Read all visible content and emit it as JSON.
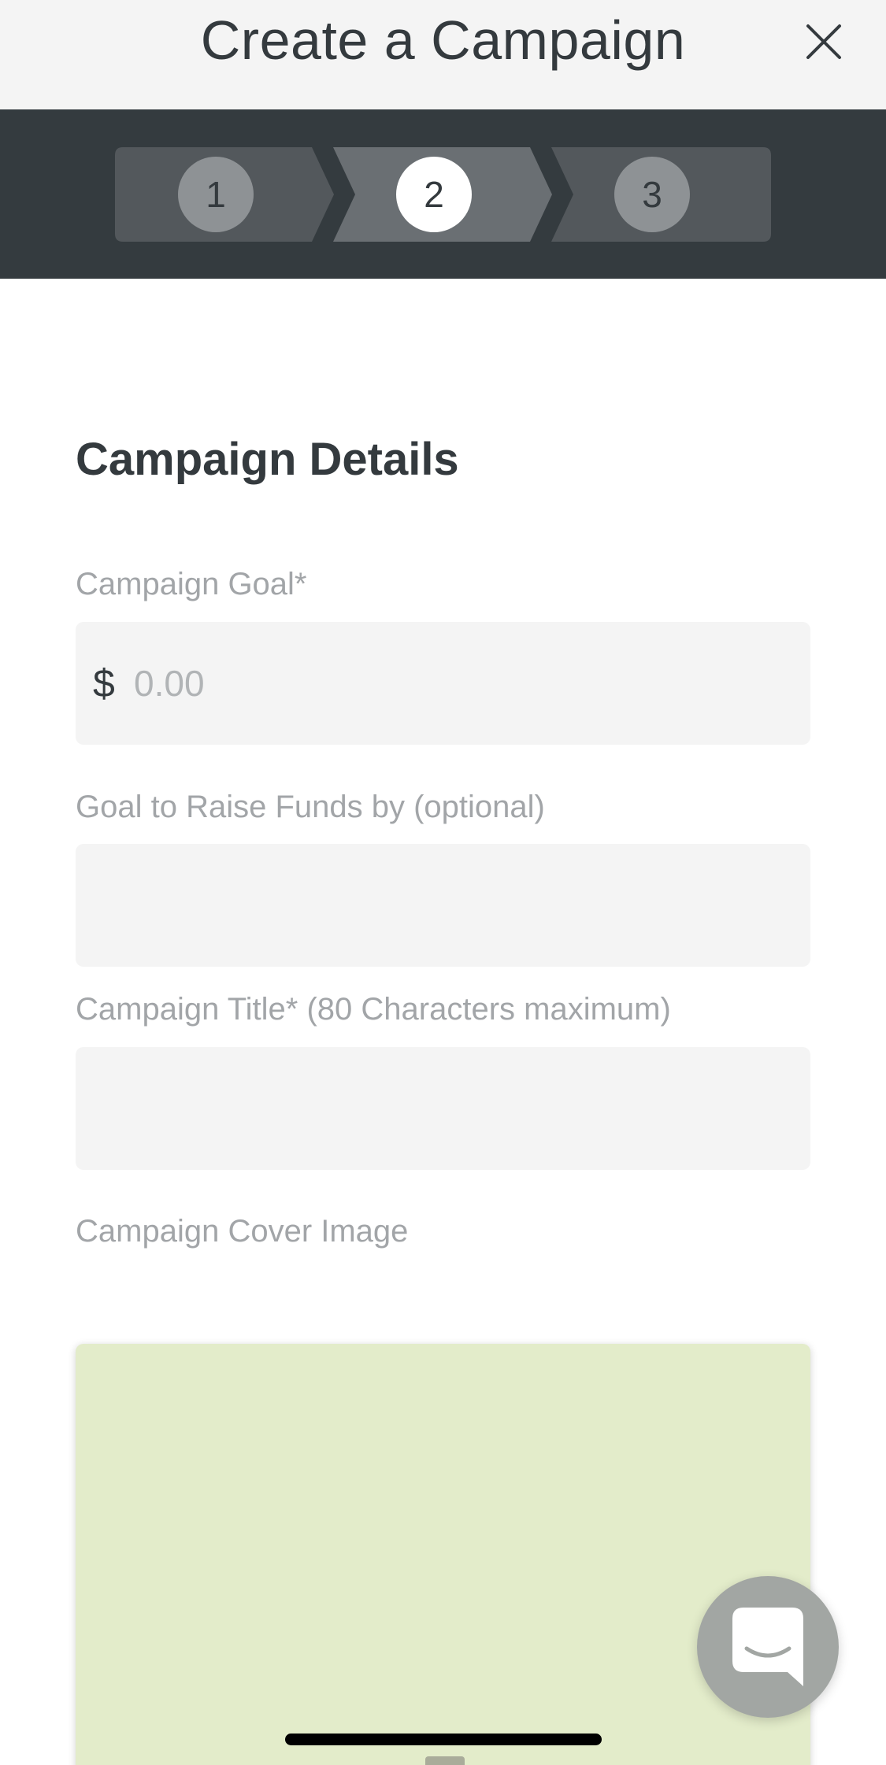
{
  "header": {
    "title": "Create a Campaign",
    "close_icon": "close-icon"
  },
  "stepper": {
    "current_step": 2,
    "steps": [
      {
        "label": "1",
        "state": "inactive"
      },
      {
        "label": "2",
        "state": "active"
      },
      {
        "label": "3",
        "state": "inactive"
      }
    ]
  },
  "form": {
    "section_title": "Campaign Details",
    "goal": {
      "label": "Campaign Goal*",
      "currency_symbol": "$",
      "placeholder": "0.00",
      "value": ""
    },
    "raise_by": {
      "label": "Goal to Raise Funds by (optional)",
      "value": ""
    },
    "title": {
      "label": "Campaign Title* (80 Characters maximum)",
      "value": ""
    },
    "cover_image": {
      "label": "Campaign Cover Image"
    }
  },
  "chat": {
    "icon": "chat-bubble-icon"
  },
  "colors": {
    "header_bg": "#f4f4f4",
    "stepper_bg": "#343b3f",
    "text_dark": "#343a3e",
    "label_gray": "#a2a5a8",
    "input_bg": "#f4f4f4",
    "cover_bg": "#e3ecca",
    "fab_bg": "#a2a6a3"
  }
}
